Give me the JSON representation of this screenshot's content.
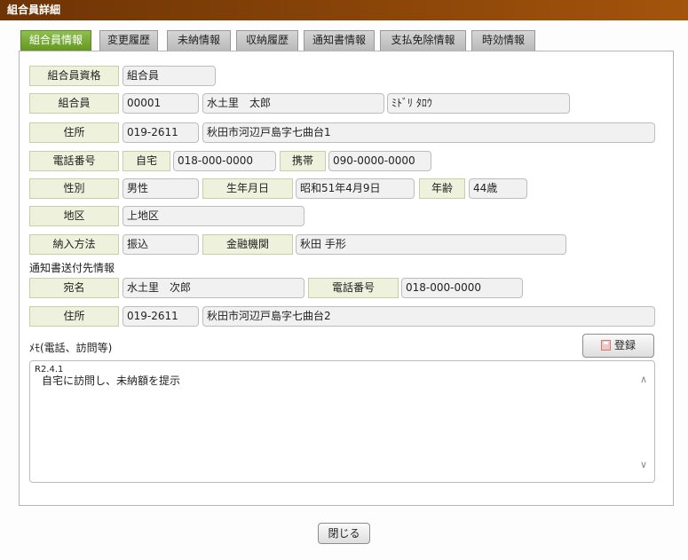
{
  "window": {
    "title": "組合員詳細"
  },
  "tabs": [
    {
      "label": "組合員情報",
      "active": true
    },
    {
      "label": "変更履歴"
    },
    {
      "label": "未納情報"
    },
    {
      "label": "収納履歴"
    },
    {
      "label": "通知書情報"
    },
    {
      "label": "支払免除情報"
    },
    {
      "label": "時効情報"
    }
  ],
  "member": {
    "qualification_label": "組合員資格",
    "qualification": "組合員",
    "member_label": "組合員",
    "member_id": "00001",
    "name": "水土里　太郎",
    "kana": "ﾐﾄﾞﾘ ﾀﾛｳ",
    "address_label": "住所",
    "postal_code": "019-2611",
    "address": "秋田市河辺戸島字七曲台1",
    "phone_label": "電話番号",
    "home_label": "自宅",
    "home_phone": "018-000-0000",
    "mobile_label": "携帯",
    "mobile_phone": "090-0000-0000",
    "gender_label": "性別",
    "gender": "男性",
    "birthdate_label": "生年月日",
    "birthdate": "昭和51年4月9日",
    "age_label": "年齢",
    "age": "44歳",
    "district_label": "地区",
    "district": "上地区",
    "payment_method_label": "納入方法",
    "payment_method": "振込",
    "bank_label": "金融機関",
    "bank": "秋田 手形"
  },
  "notice": {
    "section_title": "通知書送付先情報",
    "recipient_label": "宛名",
    "recipient": "水土里　次郎",
    "phone_label": "電話番号",
    "phone": "018-000-0000",
    "address_label": "住所",
    "postal_code": "019-2611",
    "address": "秋田市河辺戸島字七曲台2"
  },
  "memo": {
    "label": "ﾒﾓ(電話、訪問等)",
    "register_button": "登録",
    "register_icon": "save-icon",
    "date_line": "R2.4.1",
    "text_line": "自宅に訪問し、未納額を提示"
  },
  "footer": {
    "close_button": "閉じる"
  },
  "colors": {
    "title_bar": "#8a4508",
    "active_tab": "#6fa12b",
    "label_bg": "#eef2dd",
    "field_bg": "#f1f1f1"
  }
}
